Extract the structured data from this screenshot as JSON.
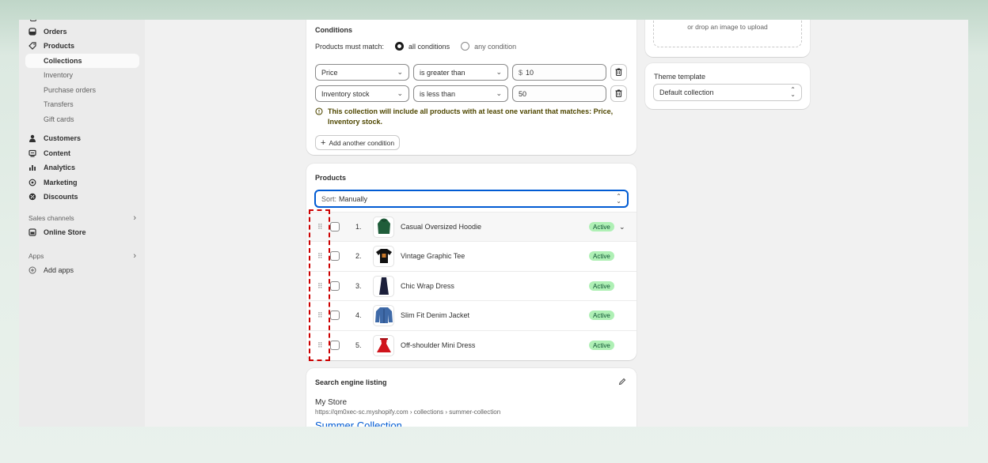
{
  "sidebar": {
    "items": [
      {
        "label": "Orders",
        "icon": "orders-icon"
      },
      {
        "label": "Products",
        "icon": "tag-icon"
      },
      {
        "label": "Collections"
      },
      {
        "label": "Inventory"
      },
      {
        "label": "Purchase orders"
      },
      {
        "label": "Transfers"
      },
      {
        "label": "Gift cards"
      },
      {
        "label": "Customers",
        "icon": "person-icon"
      },
      {
        "label": "Content",
        "icon": "content-icon"
      },
      {
        "label": "Analytics",
        "icon": "bar-chart-icon"
      },
      {
        "label": "Marketing",
        "icon": "target-icon"
      },
      {
        "label": "Discounts",
        "icon": "discount-icon"
      }
    ],
    "sales_channels_label": "Sales channels",
    "online_store_label": "Online Store",
    "apps_label": "Apps",
    "add_apps_label": "Add apps"
  },
  "conditions": {
    "title": "Conditions",
    "match_label": "Products must match:",
    "option_all": "all conditions",
    "option_any": "any condition",
    "rows": [
      {
        "field": "Price",
        "operator": "is greater than",
        "value": "10",
        "prefix": "$"
      },
      {
        "field": "Inventory stock",
        "operator": "is less than",
        "value": "50",
        "prefix": ""
      }
    ],
    "info": "This collection will include all products with at least one variant that matches: Price, Inventory stock.",
    "add_button": "Add another condition"
  },
  "products": {
    "title": "Products",
    "sort_label": "Sort:",
    "sort_value": "Manually",
    "items": [
      {
        "num": "1.",
        "name": "Casual Oversized Hoodie",
        "status": "Active"
      },
      {
        "num": "2.",
        "name": "Vintage Graphic Tee",
        "status": "Active"
      },
      {
        "num": "3.",
        "name": "Chic Wrap Dress",
        "status": "Active"
      },
      {
        "num": "4.",
        "name": "Slim Fit Denim Jacket",
        "status": "Active"
      },
      {
        "num": "5.",
        "name": "Off-shoulder Mini Dress",
        "status": "Active"
      }
    ]
  },
  "seo": {
    "title": "Search engine listing",
    "store": "My Store",
    "url": "https://qm0xec-sc.myshopify.com › collections › summer-collection",
    "page_title": "Summer Collection"
  },
  "image_upload": {
    "hint": "or drop an image to upload"
  },
  "theme": {
    "label": "Theme template",
    "value": "Default collection"
  },
  "colors": {
    "accent": "#005bd3",
    "badge_bg": "#aff0b5",
    "highlight": "#cc0000"
  }
}
